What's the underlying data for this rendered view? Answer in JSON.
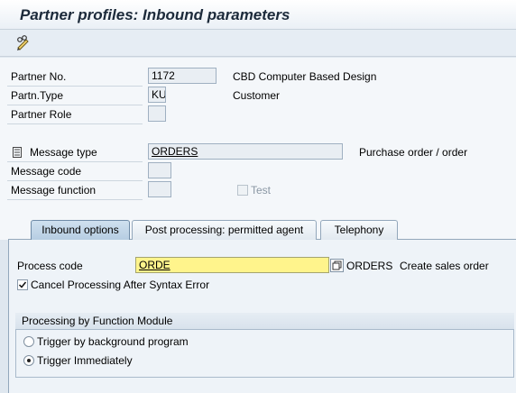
{
  "window": {
    "title": "Partner profiles: Inbound parameters"
  },
  "toolbar": {
    "edit_icon": "pencil-glasses-icon"
  },
  "header": {
    "partner_no_label": "Partner No.",
    "partner_no_value": "1172",
    "partner_no_desc": "CBD Computer Based Design",
    "partn_type_label": "Partn.Type",
    "partn_type_value": "KU",
    "partn_type_desc": "Customer",
    "partner_role_label": "Partner Role",
    "partner_role_value": "",
    "message_type_icon": "message-type-icon",
    "message_type_label": "Message type",
    "message_type_value": "ORDERS",
    "message_type_desc": "Purchase order / order",
    "message_code_label": "Message code",
    "message_code_value": "",
    "message_function_label": "Message function",
    "message_function_value": "",
    "test_label": "Test",
    "test_checked": false
  },
  "tabs": [
    {
      "label": "Inbound options",
      "active": true
    },
    {
      "label": "Post processing: permitted agent",
      "active": false
    },
    {
      "label": "Telephony",
      "active": false
    }
  ],
  "inbound": {
    "process_code_label": "Process code",
    "process_code_value": "ORDE",
    "process_code_name": "ORDERS",
    "process_code_desc": "Create sales order",
    "cancel_label": "Cancel Processing After Syntax Error",
    "cancel_checked": true,
    "group_title": "Processing by Function Module",
    "options": [
      {
        "label": "Trigger by background program",
        "selected": false
      },
      {
        "label": "Trigger Immediately",
        "selected": true
      }
    ]
  },
  "colors": {
    "title": "#1c2a3a",
    "process_code_highlight": "#fff48c",
    "active_tab": "#b6cde2"
  }
}
